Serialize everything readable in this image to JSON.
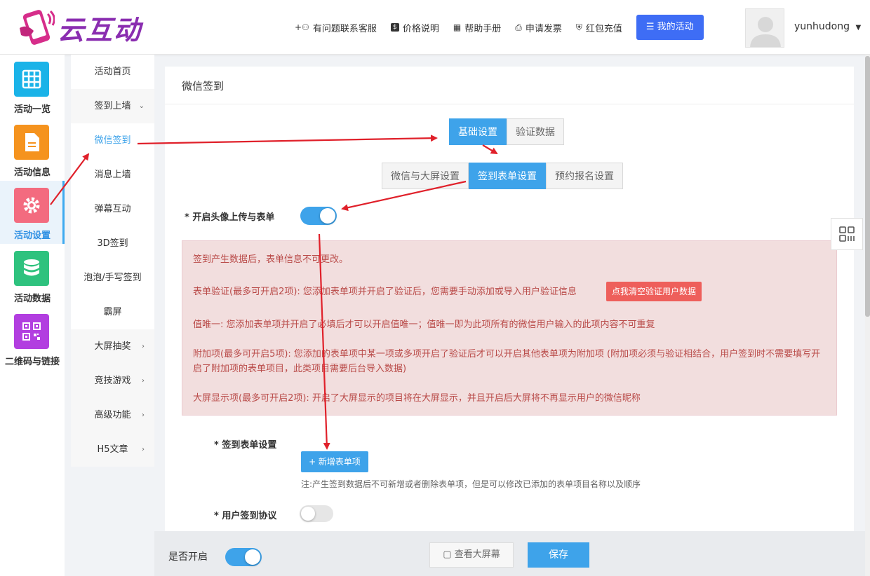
{
  "brand": {
    "name": "云互动"
  },
  "header": {
    "links": [
      {
        "label": "有问题联系客服",
        "icon": "add-user-icon"
      },
      {
        "label": "价格说明",
        "icon": "dollar-icon"
      },
      {
        "label": "帮助手册",
        "icon": "book-icon"
      },
      {
        "label": "申请发票",
        "icon": "printer-icon"
      },
      {
        "label": "红包充值",
        "icon": "shield-check-icon"
      }
    ],
    "my_activity": "我的活动",
    "username": "yunhudong"
  },
  "iconbar": {
    "items": [
      {
        "label": "活动一览",
        "color": "#1ab3e8",
        "icon": "grid-icon"
      },
      {
        "label": "活动信息",
        "color": "#f5931e",
        "icon": "document-icon"
      },
      {
        "label": "活动设置",
        "color": "#f36b7f",
        "icon": "gear-icon",
        "active": true
      },
      {
        "label": "活动数据",
        "color": "#2ec27e",
        "icon": "database-icon"
      },
      {
        "label": "二维码与链接",
        "color": "#b23ee0",
        "icon": "qrcode-icon"
      }
    ]
  },
  "subnav": {
    "items": [
      {
        "label": "活动首页"
      },
      {
        "label": "签到上墙"
      },
      {
        "label": "微信签到"
      },
      {
        "label": "消息上墙"
      },
      {
        "label": "弹幕互动"
      },
      {
        "label": "3D签到"
      },
      {
        "label": "泡泡/手写签到"
      },
      {
        "label": "霸屏"
      },
      {
        "label": "大屏抽奖"
      },
      {
        "label": "竞技游戏"
      },
      {
        "label": "高级功能"
      },
      {
        "label": "H5文章"
      }
    ]
  },
  "main": {
    "title": "微信签到",
    "tabs_primary": [
      "基础设置",
      "验证数据"
    ],
    "tabs_secondary": [
      "微信与大屏设置",
      "签到表单设置",
      "预约报名设置"
    ],
    "avatar_form_label": "* 开启头像上传与表单",
    "alert": {
      "line1": "签到产生数据后，表单信息不可更改。",
      "line2": "表单验证(最多可开启2项): 您添加表单项并开启了验证后，您需要手动添加或导入用户验证信息",
      "clear_button": "点我清空验证用户数据",
      "line3": "值唯一: 您添加表单项并开启了必填后才可以开启值唯一；值唯一即为此项所有的微信用户输入的此项内容不可重复",
      "line4": "附加项(最多可开启5项): 您添加的表单项中某一项或多项开启了验证后才可以开启其他表单项为附加项 (附加项必须与验证相结合，用户签到时不需要填写开启了附加项的表单项目，此类项目需要后台导入数据)",
      "line5": "大屏显示项(最多可开启2项): 开启了大屏显示的项目将在大屏显示，并且开启后大屏将不再显示用户的微信昵称"
    },
    "signin_form_label": "* 签到表单设置",
    "add_form_button": "+ 新增表单项",
    "note": "注:产生签到数据后不可新增或者删除表单项，但是可以修改已添加的表单项目名称以及顺序",
    "agreement_label": "* 用户签到协议"
  },
  "bottom": {
    "open_label": "是否开启",
    "view_screen": "查看大屏幕",
    "save": "保存"
  },
  "colors": {
    "accent": "#3ea3ea",
    "primary_blue": "#3e6df5",
    "annotation_red": "#e0202a"
  }
}
